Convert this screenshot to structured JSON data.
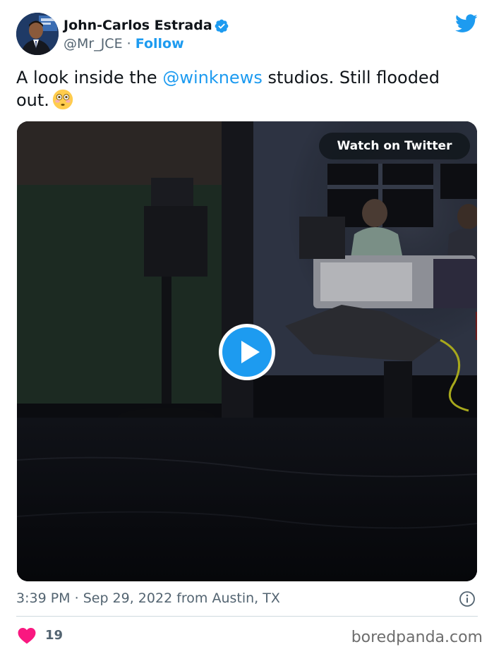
{
  "author": {
    "name": "John-Carlos Estrada",
    "handle": "@Mr_JCE",
    "separator": "·",
    "follow_label": "Follow",
    "avatar_icon": "avatar-news-anchor",
    "verified_icon": "verified-badge-icon"
  },
  "brand": {
    "icon": "twitter-bird-icon",
    "color": "#1d9bf0"
  },
  "tweet": {
    "text_before": "A look inside the ",
    "mention": "@winknews",
    "text_after": " studios. Still flooded out.",
    "emoji_icon": "flushed-face-emoji"
  },
  "media": {
    "type": "video",
    "overlay_label": "Watch on Twitter",
    "play_icon": "play-icon"
  },
  "meta": {
    "time": "3:39 PM",
    "separator": "·",
    "date": "Sep 29, 2022",
    "location": "from Austin, TX",
    "info_icon": "info-icon"
  },
  "engagement": {
    "likes": "19",
    "like_icon": "heart-icon",
    "like_color": "#f91880"
  },
  "watermark": "boredpanda.com"
}
